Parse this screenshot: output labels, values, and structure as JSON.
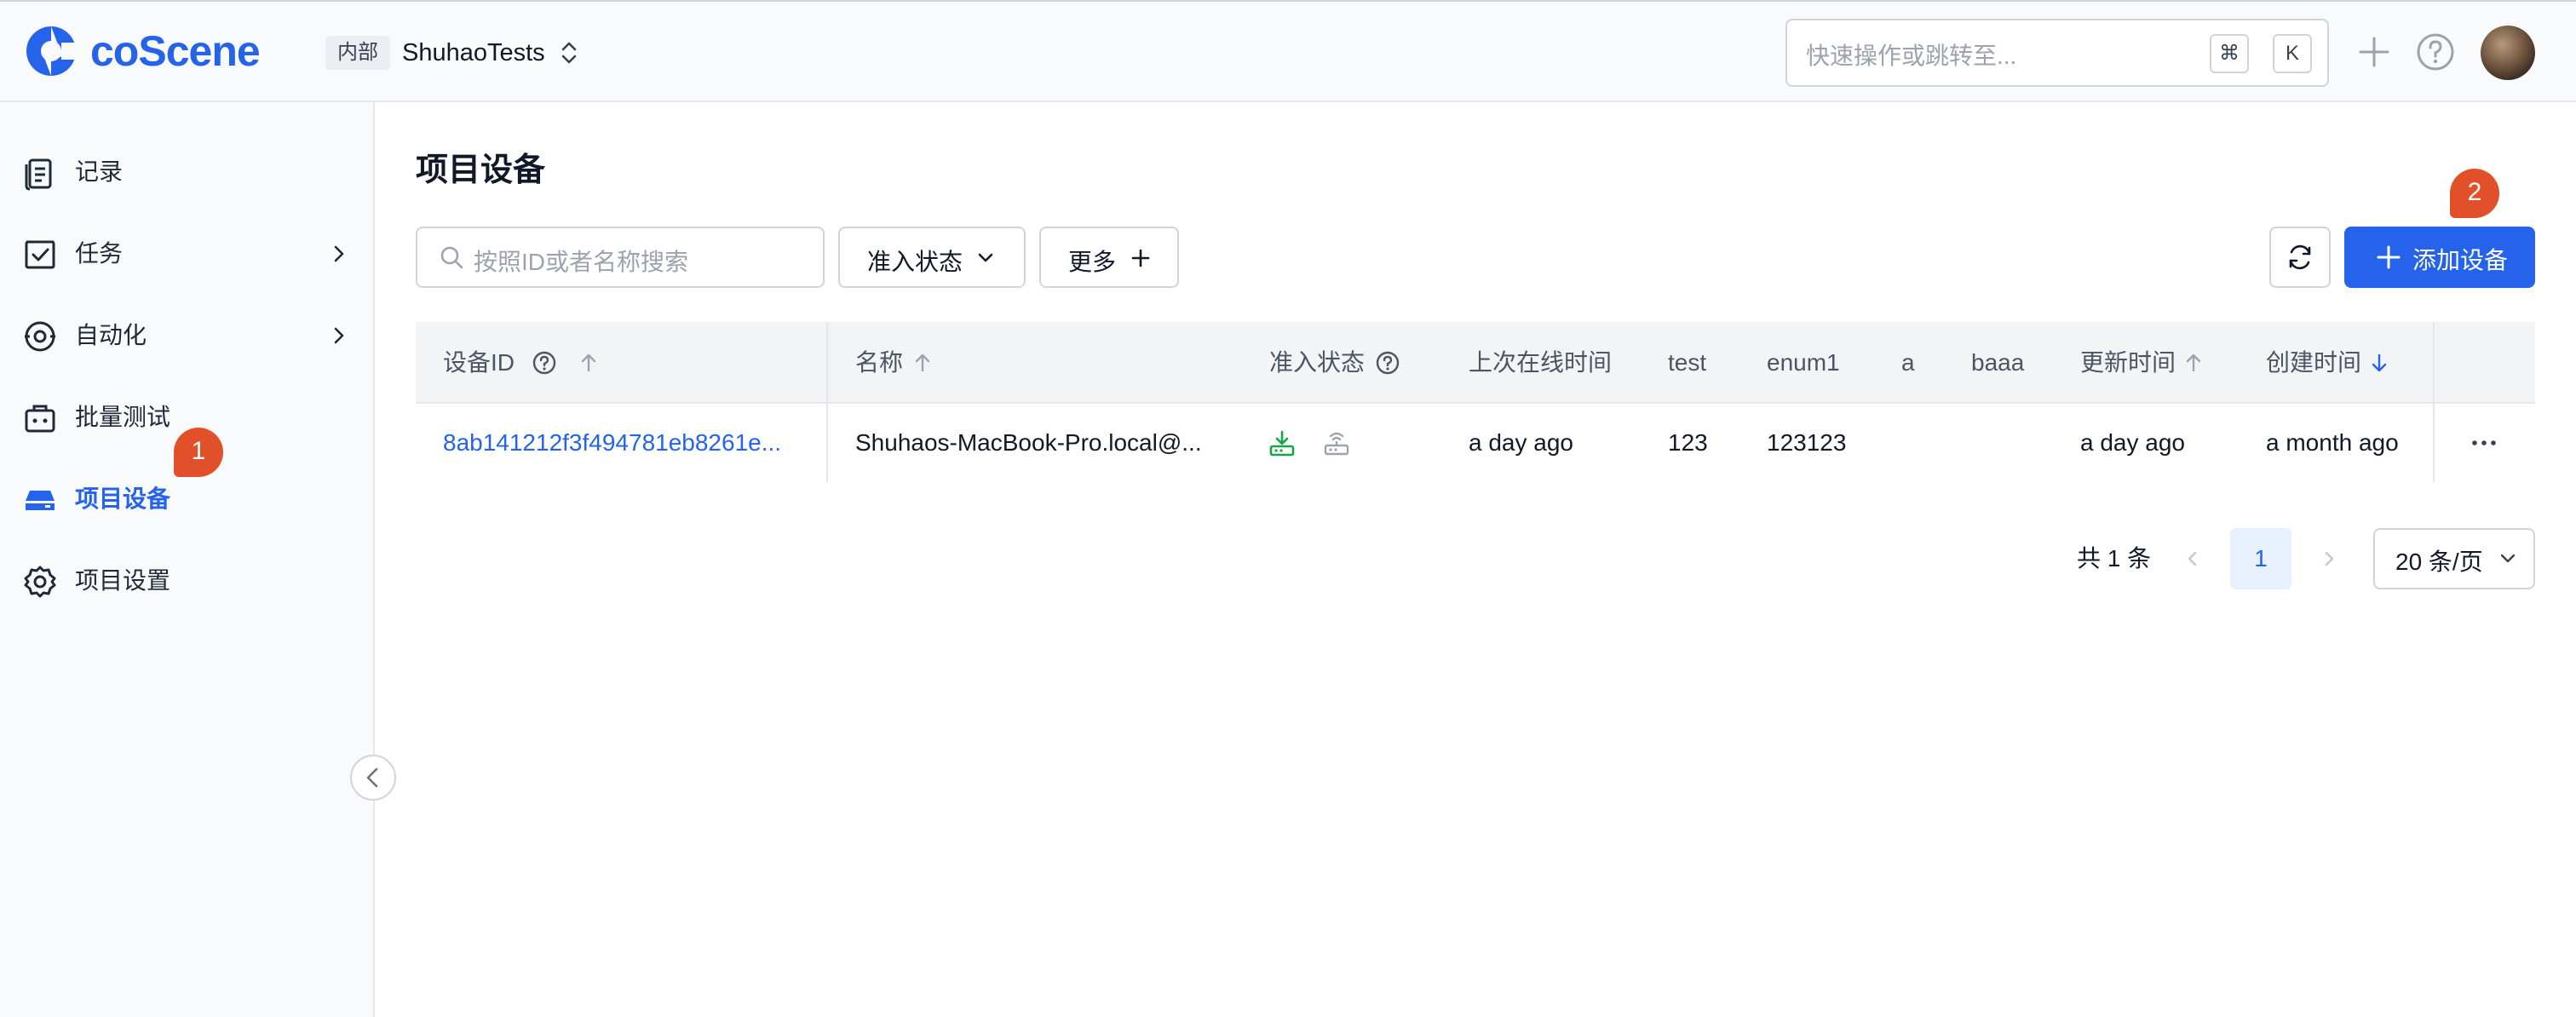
{
  "header": {
    "logo_text": "coScene",
    "org_tag": "内部",
    "org_name": "ShuhaoTests",
    "command_search": {
      "placeholder": "快速操作或跳转至...",
      "shortcut_keys": [
        "⌘",
        "K"
      ]
    },
    "icons": [
      "plus-icon",
      "help-icon"
    ]
  },
  "sidebar": {
    "items": [
      {
        "label": "记录",
        "icon": "record-icon",
        "has_submenu": false,
        "active": false
      },
      {
        "label": "任务",
        "icon": "task-icon",
        "has_submenu": true,
        "active": false
      },
      {
        "label": "自动化",
        "icon": "automation-icon",
        "has_submenu": true,
        "active": false
      },
      {
        "label": "批量测试",
        "icon": "batch-test-icon",
        "has_submenu": false,
        "active": false
      },
      {
        "label": "项目设备",
        "icon": "device-icon",
        "has_submenu": false,
        "active": true
      },
      {
        "label": "项目设置",
        "icon": "settings-icon",
        "has_submenu": false,
        "active": false
      }
    ],
    "annotation_badge": "1"
  },
  "main": {
    "title": "项目设备",
    "search_placeholder": "按照ID或者名称搜索",
    "filter_status_label": "准入状态",
    "filter_more_label": "更多",
    "add_button_label": "添加设备",
    "annotation_badge": "2",
    "accent_color": "#2563eb",
    "table": {
      "columns": [
        "设备ID",
        "名称",
        "准入状态",
        "上次在线时间",
        "test",
        "enum1",
        "a",
        "baaa",
        "更新时间",
        "创建时间"
      ],
      "rows": [
        {
          "device_id": "8ab141212f3f494781eb8261e...",
          "name": "Shuhaos-MacBook-Pro.local@...",
          "status_icons": [
            "download-device-icon",
            "router-icon"
          ],
          "last_online": "a day ago",
          "test": "123",
          "enum1": "123123",
          "a": "",
          "baaa": "",
          "updated": "a day ago",
          "created": "a month ago"
        }
      ]
    },
    "pagination": {
      "total_text": "共 1 条",
      "current_page": "1",
      "page_size": "20 条/页"
    }
  }
}
